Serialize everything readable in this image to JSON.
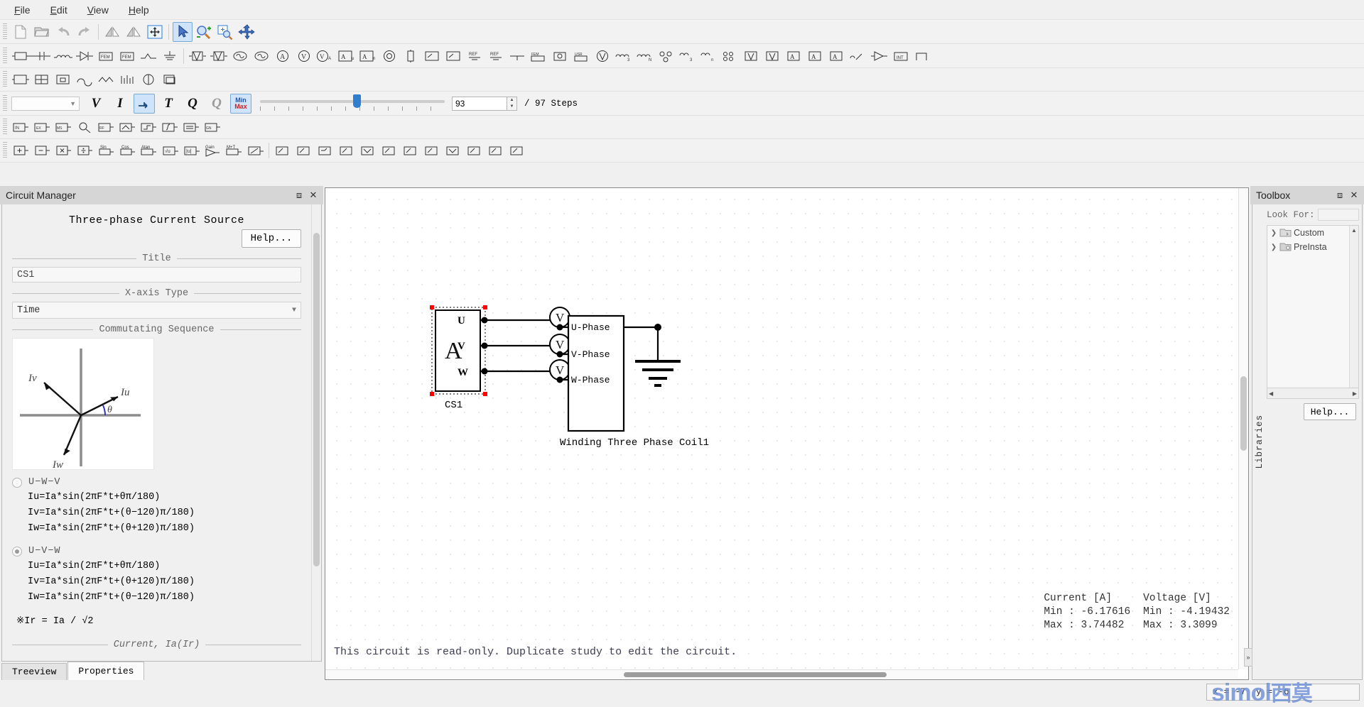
{
  "menubar": {
    "items": [
      {
        "name": "file",
        "label": "File",
        "mnemonic": "F"
      },
      {
        "name": "edit",
        "label": "Edit",
        "mnemonic": "E"
      },
      {
        "name": "view",
        "label": "View",
        "mnemonic": "V"
      },
      {
        "name": "help",
        "label": "Help",
        "mnemonic": "H"
      }
    ]
  },
  "toolbar_main": {
    "buttons": [
      {
        "name": "new-file",
        "icon": "document-icon",
        "enabled": false
      },
      {
        "name": "open-file",
        "icon": "folder-open-icon",
        "enabled": true
      },
      {
        "name": "undo",
        "icon": "undo-arrow-icon",
        "enabled": false
      },
      {
        "name": "redo",
        "icon": "redo-arrow-icon",
        "enabled": false
      },
      {
        "name": "flip-horizontal",
        "icon": "flip-horizontal-icon",
        "enabled": true
      },
      {
        "name": "flip-vertical",
        "icon": "flip-vertical-icon",
        "enabled": true
      },
      {
        "name": "fit-to-window",
        "icon": "fit-window-icon",
        "enabled": true
      },
      {
        "name": "select-tool",
        "icon": "cursor-arrow-icon",
        "active": true
      },
      {
        "name": "zoom-in",
        "icon": "zoom-in-icon",
        "enabled": true
      },
      {
        "name": "zoom-region",
        "icon": "zoom-region-icon",
        "enabled": true
      },
      {
        "name": "pan-tool",
        "icon": "pan-move-icon",
        "enabled": true
      }
    ]
  },
  "sim_toolbar": {
    "combo_value": "",
    "voltage_label": "V",
    "current_label": "I",
    "probe_label": "↦",
    "torque_label": "T",
    "charge_label": "Q",
    "charge2_label": "Q",
    "minmax_top": "Min",
    "minmax_bottom": "Max",
    "step_value": "93",
    "total_steps_label": "/ 97 Steps"
  },
  "circuit_manager": {
    "panel_title": "Circuit Manager",
    "component_title": "Three-phase Current Source",
    "help_button": "Help...",
    "title_group": "Title",
    "title_value": "CS1",
    "xaxis_group": "X-axis Type",
    "xaxis_value": "Time",
    "commutating_group": "Commutating Sequence",
    "phasor": {
      "iu_label": "Iu",
      "iv_label": "Iv",
      "iw_label": "Iw",
      "theta_label": "θ"
    },
    "options": [
      {
        "name": "u-w-v",
        "label": "U−W−V",
        "selected": false,
        "formulas": [
          "Iu=Ia*sin(2πF*t+θπ/180)",
          "Iv=Ia*sin(2πF*t+(θ−120)π/180)",
          "Iw=Ia*sin(2πF*t+(θ+120)π/180)"
        ]
      },
      {
        "name": "u-v-w",
        "label": "U−V−W",
        "selected": true,
        "formulas": [
          "Iu=Ia*sin(2πF*t+θπ/180)",
          "Iv=Ia*sin(2πF*t+(θ+120)π/180)",
          "Iw=Ia*sin(2πF*t+(θ−120)π/180)"
        ]
      }
    ],
    "note": "※Ir = Ia / √2",
    "current_group": "Current, Ia(Ir)",
    "tabs": [
      {
        "name": "treeview",
        "label": "Treeview",
        "selected": false
      },
      {
        "name": "properties",
        "label": "Properties",
        "selected": true
      }
    ]
  },
  "canvas": {
    "readonly_message": "This circuit is read-only. Duplicate study to edit the circuit.",
    "source_label": "CS1",
    "source_symbol": "A",
    "terminals": [
      "U",
      "V",
      "W"
    ],
    "coil_label": "Winding Three Phase Coil1",
    "coil_phases": [
      "U-Phase",
      "V-Phase",
      "W-Phase"
    ],
    "measurements": {
      "current_header": "Current [A]",
      "voltage_header": "Voltage [V]",
      "current_min": "Min : -6.17616",
      "current_max": "Max : 3.74482",
      "voltage_min": "Min : -4.19432",
      "voltage_max": "Max : 3.3099"
    }
  },
  "toolbox": {
    "panel_title": "Toolbox",
    "vertical_label": "Libraries",
    "look_for_label": "Look For:",
    "look_for_value": "",
    "tree_items": [
      {
        "name": "custom",
        "label": "Custom"
      },
      {
        "name": "preinstalled",
        "label": "PreInsta"
      }
    ],
    "help_button": "Help..."
  },
  "statusbar": {
    "x_label": "x = -7",
    "y_label": "y = -6",
    "watermark_latin": "simol",
    "watermark_cjk": "西莫"
  },
  "colors": {
    "accent": "#2f7fd1",
    "active_tool_bg": "#cfe4fa",
    "panel_bg": "#f0f0f0",
    "titlebar_bg": "#d6d6d6",
    "selection_handle": "#ff0000",
    "watermark": "#6e8fd6"
  }
}
